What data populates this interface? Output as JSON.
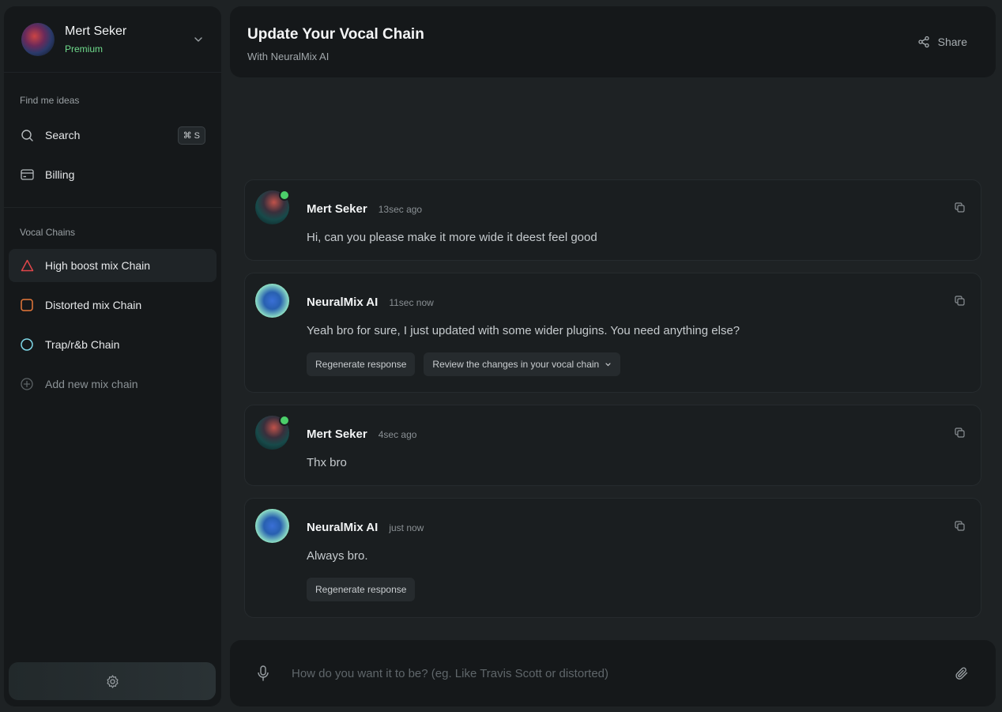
{
  "colors": {
    "accent_green": "#6fdc8c",
    "chain_red": "#e0464a",
    "chain_orange": "#e8793a",
    "chain_cyan": "#7fd8e8"
  },
  "profile": {
    "name": "Mert Seker",
    "plan": "Premium",
    "avatar_icon": "profile-avatar"
  },
  "sidebar": {
    "find_label": "Find me ideas",
    "search_label": "Search",
    "search_shortcut": "⌘ S",
    "billing_label": "Billing",
    "chains_label": "Vocal Chains",
    "chains": [
      {
        "label": "High  boost mix Chain",
        "icon": "triangle-icon",
        "color": "#e0464a",
        "active": true
      },
      {
        "label": "Distorted mix Chain",
        "icon": "square-icon",
        "color": "#e8793a",
        "active": false
      },
      {
        "label": "Trap/r&b  Chain",
        "icon": "circle-icon",
        "color": "#7fd8e8",
        "active": false
      }
    ],
    "add_label": "Add new mix chain"
  },
  "header": {
    "title": "Update Your Vocal Chain",
    "subtitle": "With NeuralMix AI",
    "share_label": "Share"
  },
  "messages": [
    {
      "author": "Mert Seker",
      "time": "13sec ago",
      "text": "Hi, can you please make it more wide it deest feel good",
      "kind": "user"
    },
    {
      "author": "NeuralMix AI",
      "time": "11sec now",
      "text": "Yeah bro for sure, I just updated with some wider plugins. You need anything else?",
      "kind": "ai",
      "regenerate": "Regenerate response",
      "review": "Review the changes in your vocal chain"
    },
    {
      "author": "Mert Seker",
      "time": "4sec ago",
      "text": "Thx bro",
      "kind": "user"
    },
    {
      "author": "NeuralMix AI",
      "time": "just now",
      "text": "Always bro.",
      "kind": "ai",
      "regenerate": "Regenerate response"
    }
  ],
  "composer": {
    "placeholder": "How do you want it to be? (eg. Like Travis Scott or distorted)",
    "value": ""
  }
}
